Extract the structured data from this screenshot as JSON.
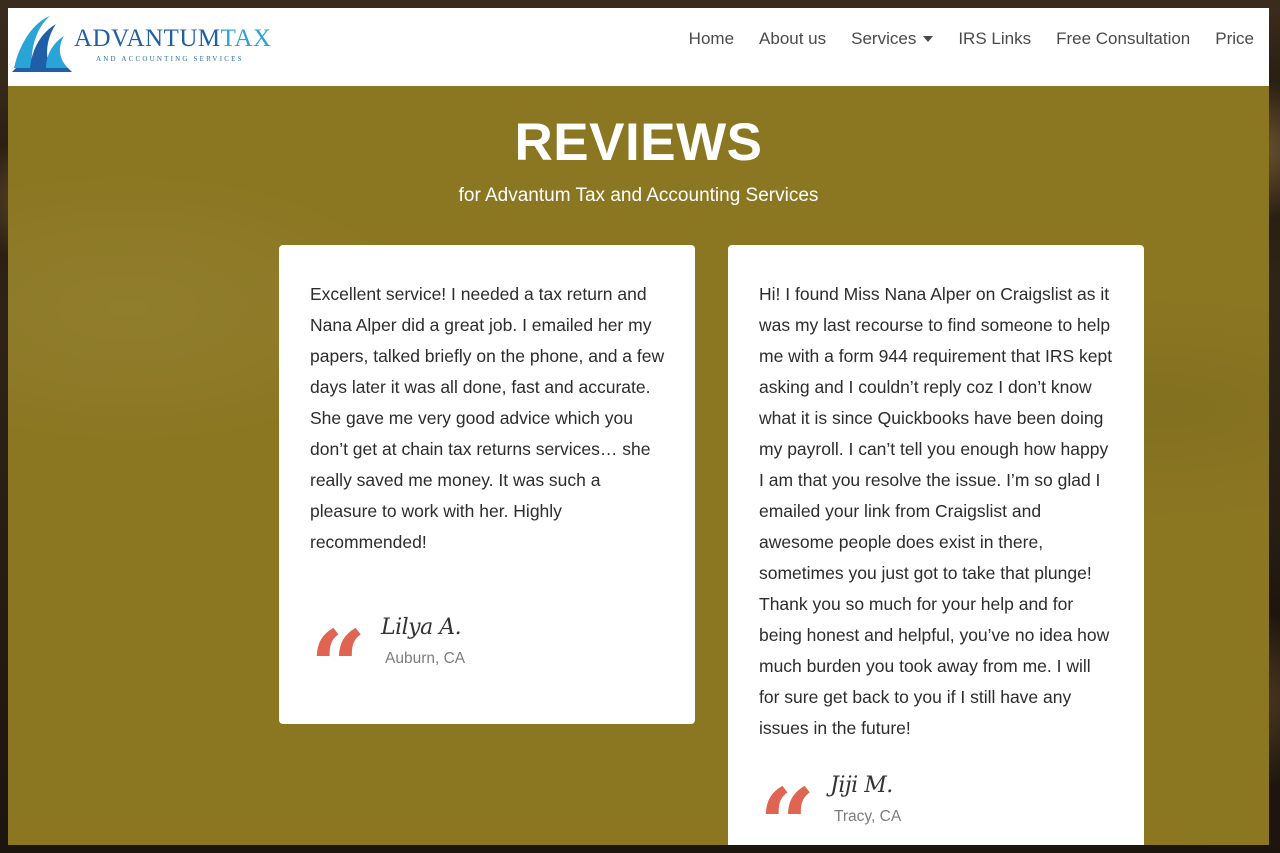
{
  "logo": {
    "brand_part1": "ADVANTUM",
    "brand_part2": "TAX",
    "tagline": "AND ACCOUNTING SERVICES",
    "icon": "wave-swoosh-icon"
  },
  "nav": {
    "items": [
      {
        "label": "Home"
      },
      {
        "label": "About us"
      },
      {
        "label": "Services",
        "has_dropdown": true
      },
      {
        "label": "IRS Links"
      },
      {
        "label": "Free Consultation"
      },
      {
        "label": "Price"
      }
    ]
  },
  "hero": {
    "title": "REVIEWS",
    "subtitle": "for Advantum Tax and Accounting Services"
  },
  "reviews": [
    {
      "text": "Excellent service! I needed a tax return and Nana Alper did a great job. I emailed her my papers, talked briefly on the phone, and a few days later it was all done, fast and accurate. She gave me very good advice which you don’t get at chain tax returns services… she really saved me money. It was such a pleasure to work with her. Highly recommended!",
      "signature": "Lilya A.",
      "location": "Auburn, CA"
    },
    {
      "text": "Hi! I found Miss Nana Alper on Craigslist as it was my last recourse to find someone to help me with a form 944 requirement that IRS kept asking and I couldn’t reply coz I don’t know what it is since Quickbooks have been doing my payroll. I can’t tell you enough how happy I am that you resolve the issue. I’m so glad I emailed your link from Craigslist and awesome people does exist in there, sometimes you just got to take that plunge! Thank you so much for your help and for being honest and helpful, you’ve no idea how much burden you took away from me. I will for sure get back to you if I still have any issues in the future!",
      "signature": "Jiji M.",
      "location": "Tracy, CA"
    }
  ],
  "colors": {
    "section_bg": "#8b7722",
    "quote_accent": "#e06452",
    "logo_dark_blue": "#1f5fa8",
    "logo_light_blue": "#2aa3d6"
  }
}
